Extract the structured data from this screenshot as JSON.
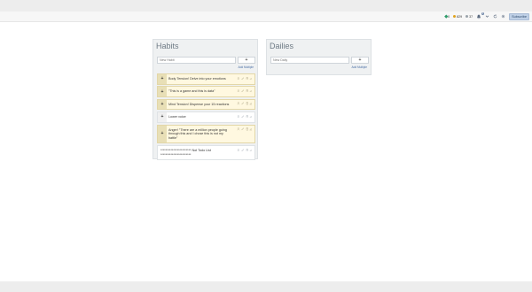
{
  "header": {
    "gems": "0",
    "gold": "829",
    "silver": "37",
    "notifications": "3",
    "subscribe_label": "Subscribe",
    "colors": {
      "gem": "#2e9c6a",
      "gold": "#e0a21b",
      "silver": "#9aa3ab",
      "badge": "#6d84a6"
    }
  },
  "habits": {
    "title": "Habits",
    "new_placeholder": "New Habit",
    "add_label": "+",
    "add_multiple": "Add Multiple",
    "tasks": [
      {
        "text": "Body Tension! Delve into your emotions",
        "color": "yellow"
      },
      {
        "text": "\"This is a game and this is data\"",
        "color": "yellow"
      },
      {
        "text": "Mind Tension! Dispense your 15 reactions",
        "color": "yellow"
      },
      {
        "text": "Lower voice",
        "color": "white"
      },
      {
        "text": "Anger! \"There are a million people going through this and I chose this is not my battle\"",
        "color": "yellow"
      },
      {
        "text": "************************ Not Todo List ************************",
        "color": "white"
      }
    ]
  },
  "dailies": {
    "title": "Dailies",
    "new_placeholder": "New Daily",
    "add_label": "+",
    "add_multiple": "Add Multiple"
  }
}
